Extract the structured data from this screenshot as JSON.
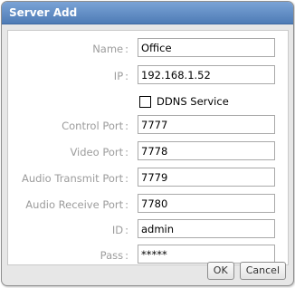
{
  "dialog": {
    "title": "Server Add",
    "colors": {
      "titlebar_top": "#7aa3d6",
      "titlebar_bottom": "#4f7cb6",
      "dialog_bg": "#e7e7e7",
      "label_text": "#9c9c9c"
    }
  },
  "form": {
    "fields": [
      {
        "key": "name",
        "label": "Name",
        "value": "Office"
      },
      {
        "key": "ip",
        "label": "IP",
        "value": "192.168.1.52"
      },
      {
        "key": "control_port",
        "label": "Control Port",
        "value": "7777"
      },
      {
        "key": "video_port",
        "label": "Video Port",
        "value": "7778"
      },
      {
        "key": "audio_transmit_port",
        "label": "Audio Transmit Port",
        "value": "7779"
      },
      {
        "key": "audio_receive_port",
        "label": "Audio Receive Port",
        "value": "7780"
      },
      {
        "key": "id",
        "label": "ID",
        "value": "admin"
      },
      {
        "key": "pass",
        "label": "Pass",
        "value": "*****"
      }
    ],
    "ddns": {
      "label": "DDNS Service",
      "checked": false
    }
  },
  "buttons": {
    "ok_label": "OK",
    "cancel_label": "Cancel"
  }
}
